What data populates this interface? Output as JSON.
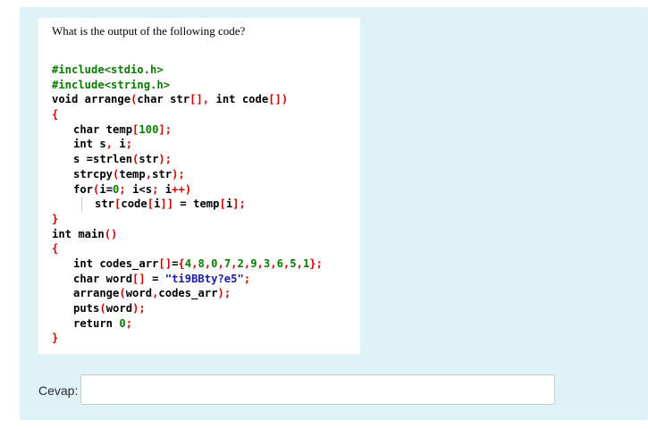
{
  "question": {
    "text": "What is the output of the following code?"
  },
  "code_lines": [
    "#include<stdio.h>",
    "#include<string.h>",
    "void arrange(char str[], int code[])",
    "{",
    "char temp[100];",
    "int s, i;",
    "s =strlen(str);",
    "strcpy(temp,str);",
    "for(i=0; i<s; i++)",
    "str[code[i]] = temp[i];",
    "}",
    "int main()",
    "{",
    "int codes_arr[]={4,8,0,7,2,9,3,6,5,1};",
    "char word[] = \"ti9BBty?e5\";",
    "arrange(word,codes_arr);",
    "puts(word);",
    "return 0;",
    "}"
  ],
  "answer": {
    "label": "Cevap:",
    "value": "",
    "placeholder": ""
  },
  "colors": {
    "panel_background": "#def2f8",
    "preprocessor": "#0a7a00",
    "punctuation": "#d00000",
    "number": "#0a7a00",
    "string": "#1a1aa6"
  }
}
